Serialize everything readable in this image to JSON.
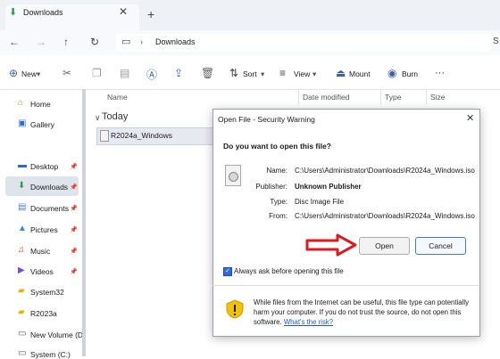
{
  "tab": {
    "title": "Downloads"
  },
  "address": {
    "path": "Downloads"
  },
  "toolbar": {
    "new": "New",
    "sort": "Sort",
    "view": "View",
    "mount": "Mount",
    "burn": "Burn"
  },
  "sidebar": {
    "home": "Home",
    "gallery": "Gallery",
    "desktop": "Desktop",
    "downloads": "Downloads",
    "documents": "Documents",
    "pictures": "Pictures",
    "music": "Music",
    "videos": "Videos",
    "system32": "System32",
    "r2023a": "R2023a",
    "new_volume": "New Volume (D:",
    "system_c": "System (C:)"
  },
  "columns": {
    "name": "Name",
    "date": "Date modified",
    "type": "Type",
    "size": "Size"
  },
  "group": "Today",
  "file": "R2024a_Windows",
  "dialog": {
    "title": "Open File - Security Warning",
    "question": "Do you want to open this file?",
    "name_label": "Name:",
    "name_value": "C:\\Users\\Administrator\\Downloads\\R2024a_Windows.iso",
    "publisher_label": "Publisher:",
    "publisher_value": "Unknown Publisher",
    "type_label": "Type:",
    "type_value": "Disc Image File",
    "from_label": "From:",
    "from_value": "C:\\Users\\Administrator\\Downloads\\R2024a_Windows.iso",
    "open": "Open",
    "cancel": "Cancel",
    "checkbox": "Always ask before opening this file",
    "warning": "While files from the Internet can be useful, this file type can potentially harm your computer. If you do not trust the source, do not open this software.",
    "risk_link": "What's the risk?"
  }
}
